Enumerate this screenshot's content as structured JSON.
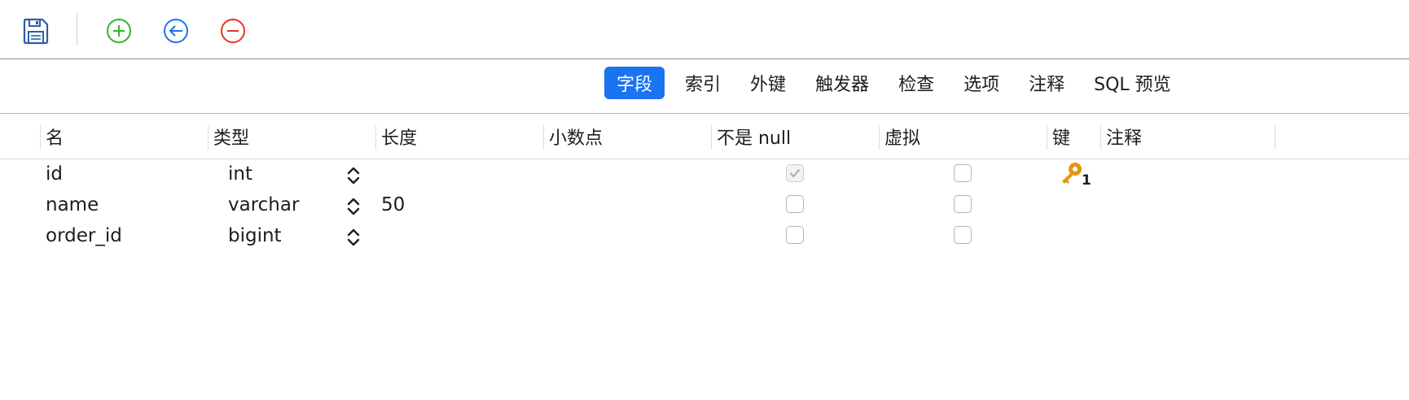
{
  "toolbar": {
    "buttons": [
      {
        "name": "save-button",
        "icon": "save-icon",
        "color": "#2c5fa8"
      },
      {
        "name": "add-field-button",
        "icon": "plus-circle-icon",
        "color": "#2fb52f"
      },
      {
        "name": "insert-field-button",
        "icon": "arrow-left-circle-icon",
        "color": "#1a73f0"
      },
      {
        "name": "delete-field-button",
        "icon": "minus-circle-icon",
        "color": "#e5332a"
      }
    ]
  },
  "tabs": [
    {
      "label": "字段",
      "active": true
    },
    {
      "label": "索引",
      "active": false
    },
    {
      "label": "外键",
      "active": false
    },
    {
      "label": "触发器",
      "active": false
    },
    {
      "label": "检查",
      "active": false
    },
    {
      "label": "选项",
      "active": false
    },
    {
      "label": "注释",
      "active": false
    },
    {
      "label": "SQL 预览",
      "active": false
    }
  ],
  "grid": {
    "columns": [
      "名",
      "类型",
      "长度",
      "小数点",
      "不是 null",
      "虚拟",
      "键",
      "注释"
    ],
    "rows": [
      {
        "name": "id",
        "type": "int",
        "length": "",
        "decimals": "",
        "not_null": true,
        "not_null_disabled": true,
        "virtual": false,
        "key": "1",
        "comment": ""
      },
      {
        "name": "name",
        "type": "varchar",
        "length": "50",
        "decimals": "",
        "not_null": false,
        "not_null_disabled": false,
        "virtual": false,
        "key": "",
        "comment": ""
      },
      {
        "name": "order_id",
        "type": "bigint",
        "length": "",
        "decimals": "",
        "not_null": false,
        "not_null_disabled": false,
        "virtual": false,
        "key": "",
        "comment": ""
      }
    ]
  },
  "colors": {
    "accent": "#1a73f0",
    "key": "#e8950f"
  }
}
